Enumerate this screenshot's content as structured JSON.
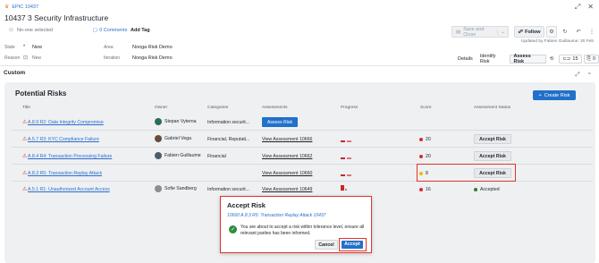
{
  "header": {
    "epic_label": "EPIC 10437",
    "issue_title": "10437  3 Security Infrastructure",
    "assignee": "No-one selected",
    "comments": "0 Comments",
    "add_tag": "Add Tag",
    "save_close": "Save and Close",
    "follow": "Follow",
    "updated": "Updated by Fabien Guillaume: 20 Feb"
  },
  "fields": {
    "state_label": "State",
    "state_value": "New",
    "area_label": "Area",
    "area_value": "Nooga Risk Demo",
    "reason_label": "Reason",
    "reason_value": "New",
    "iteration_label": "Iteration",
    "iteration_value": "Nooga Risk Demo"
  },
  "tabs": [
    {
      "label": "Details"
    },
    {
      "label": "Identify Risk"
    },
    {
      "label": "Assess Risk"
    }
  ],
  "tab_counts": {
    "links": "15",
    "attachments": "0"
  },
  "section": {
    "custom_label": "Custom",
    "panel_title": "Potential Risks",
    "create_button": "Create Risk"
  },
  "table": {
    "columns": [
      "Title",
      "Owner",
      "Categories",
      "Assessments",
      "Progress",
      "Score",
      "Assessment Status"
    ],
    "rows": [
      {
        "title": "A.8.9 R2: Data Integrity Compromise",
        "owner": "Stepan Vyterna",
        "categories": "Information securit...",
        "assessment": "Assess Risk",
        "score": "",
        "status": ""
      },
      {
        "title": "A.5.7 R3: KYC Compliance Failure",
        "owner": "Gabriel Vega",
        "categories": "Financial, Reputati...",
        "assessment": "View Assessment 10666",
        "score": "20",
        "status": "Accept Risk"
      },
      {
        "title": "A.8.4 R4: Transaction Processing Failure",
        "owner": "Fabien Guillaume",
        "categories": "Financial",
        "assessment": "View Assessment 10662",
        "score": "20",
        "status": "Accept Risk"
      },
      {
        "title": "A.8.3 R5: Transaction Replay Attack",
        "owner": "",
        "categories": "",
        "assessment": "View Assessment 10660",
        "score": "8",
        "status": "Accept Risk"
      },
      {
        "title": "A.5.1 R1: Unauthorized Account Access",
        "owner": "Sofie Sandberg",
        "categories": "Information securit...",
        "assessment": "View Assessment 10649",
        "score": "16",
        "status": "Accepted"
      }
    ]
  },
  "modal": {
    "title": "Accept Risk",
    "link": "10660 A.8.3 R5: Transaction Replay Attack 10437",
    "message": "You are about to accept a risk within tolerance level, ensure all relevant parties has been informed.",
    "cancel": "Cancel",
    "accept": "Accept"
  },
  "colors": {
    "primary": "#2170c9",
    "score_red": "#d32f2f",
    "score_yellow": "#f2b705",
    "accepted_green": "#2e7d32",
    "highlight": "#e0332c"
  }
}
